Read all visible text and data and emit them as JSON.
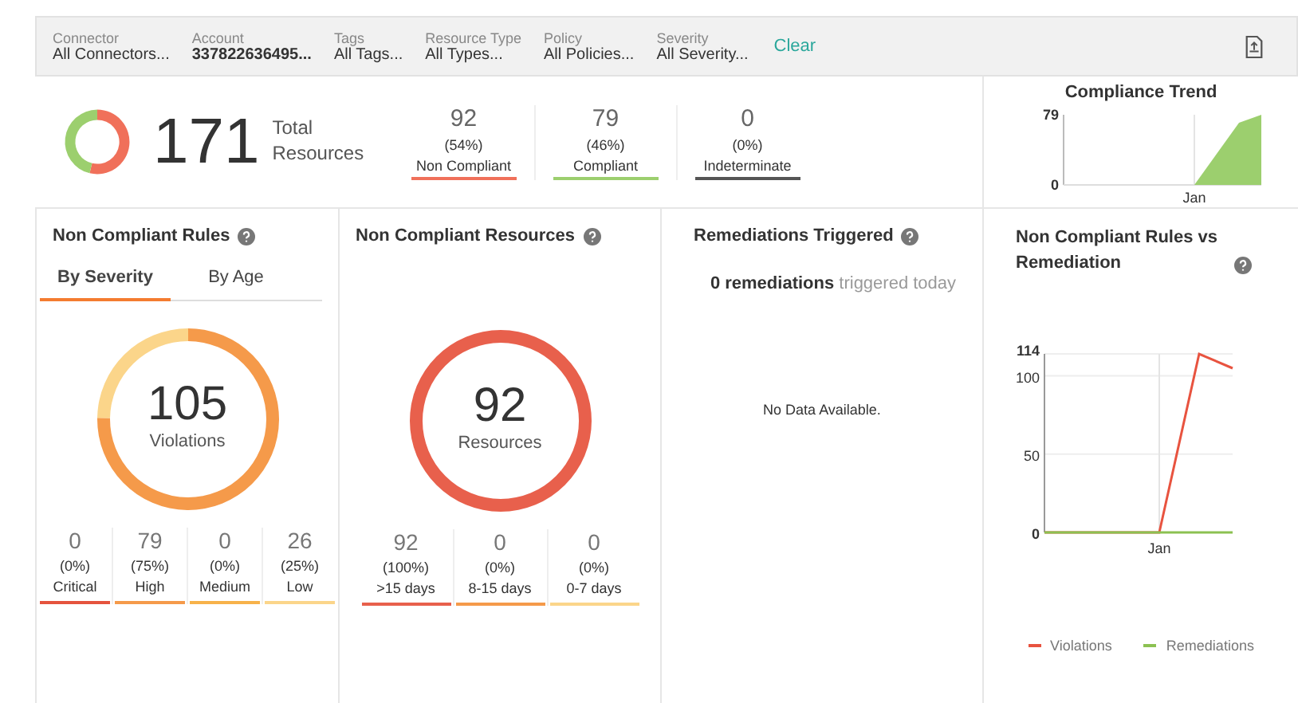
{
  "filters": [
    {
      "label": "Connector",
      "value": "All Connectors...",
      "active": false
    },
    {
      "label": "Account",
      "value": "337822636495...",
      "active": true
    },
    {
      "label": "Tags",
      "value": "All Tags...",
      "active": false
    },
    {
      "label": "Resource Type",
      "value": "All Types...",
      "active": false
    },
    {
      "label": "Policy",
      "value": "All Policies...",
      "active": false
    },
    {
      "label": "Severity",
      "value": "All Severity...",
      "active": false
    }
  ],
  "clear_link": "Clear",
  "summary": {
    "total": "171",
    "total_label": "Total Resources",
    "stats": [
      {
        "value": "92",
        "percent": "(54%)",
        "label": "Non Compliant",
        "color": "#f0705a"
      },
      {
        "value": "79",
        "percent": "(46%)",
        "label": "Compliant",
        "color": "#9ccf6e"
      },
      {
        "value": "0",
        "percent": "(0%)",
        "label": "Indeterminate",
        "color": "#555555"
      }
    ],
    "trend": {
      "title": "Compliance Trend",
      "y_labels": [
        "79",
        "0"
      ],
      "x_label": "Jan",
      "color": "#9ccf6e"
    }
  },
  "rules_panel": {
    "title": "Non Compliant Rules",
    "tabs": [
      {
        "label": "By Severity",
        "selected": true
      },
      {
        "label": "By Age",
        "selected": false
      }
    ],
    "center_value": "105",
    "center_label": "Violations",
    "stats": [
      {
        "value": "0",
        "percent": "(0%)",
        "label": "Critical",
        "color": "#e5533d"
      },
      {
        "value": "79",
        "percent": "(75%)",
        "label": "High",
        "color": "#f59a4a"
      },
      {
        "value": "0",
        "percent": "(0%)",
        "label": "Medium",
        "color": "#f7b24a"
      },
      {
        "value": "26",
        "percent": "(25%)",
        "label": "Low",
        "color": "#fbd58a"
      }
    ]
  },
  "resources_panel": {
    "title": "Non Compliant Resources",
    "center_value": "92",
    "center_label": "Resources",
    "stats": [
      {
        "value": "92",
        "percent": "(100%)",
        "label": ">15 days",
        "color": "#e8604c"
      },
      {
        "value": "0",
        "percent": "(0%)",
        "label": "8-15 days",
        "color": "#f59a4a"
      },
      {
        "value": "0",
        "percent": "(0%)",
        "label": "0-7 days",
        "color": "#fbd58a"
      }
    ]
  },
  "remediations_panel": {
    "title": "Remediations Triggered",
    "summary": "**0 remediations** triggered today",
    "empty_message": "No Data Available."
  },
  "comparison_panel": {
    "title": "Non Compliant Rules vs Remediation",
    "y_labels": [
      "114",
      "100",
      "50",
      "0"
    ],
    "x_label": "Jan",
    "legend": [
      {
        "name": "Violations",
        "color": "#e8533f"
      },
      {
        "name": "Remediations",
        "color": "#8cc152"
      }
    ]
  }
}
